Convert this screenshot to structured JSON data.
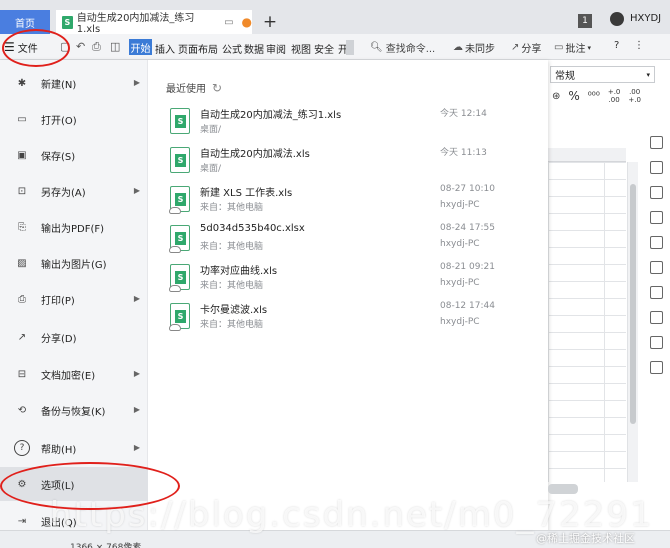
{
  "tabs": {
    "home": "首页",
    "doc_title": "自动生成20内加减法_练习1.xls",
    "badge": "1",
    "username": "HXYDJ"
  },
  "menubar": {
    "file": "文件",
    "start": "开始",
    "items": [
      "插入",
      "页面布局",
      "公式",
      "数据",
      "审阅",
      "视图",
      "安全",
      "开"
    ],
    "search": "查找命令...",
    "sync": "未同步",
    "share": "分享",
    "annotate": "批注",
    "help": "?",
    "more": "⋮"
  },
  "sheet": {
    "number_format": "常规",
    "decimal_up": "+.0\n.00",
    "decimal_down": ".00\n+.0"
  },
  "nav": {
    "items": [
      {
        "label": "新建(N)",
        "icon": "new-icon",
        "arrow": true
      },
      {
        "label": "打开(O)",
        "icon": "folder-open-icon",
        "arrow": false
      },
      {
        "label": "保存(S)",
        "icon": "save-icon",
        "arrow": false
      },
      {
        "label": "另存为(A)",
        "icon": "save-as-icon",
        "arrow": true
      },
      {
        "label": "输出为PDF(F)",
        "icon": "pdf-icon",
        "arrow": false
      },
      {
        "label": "输出为图片(G)",
        "icon": "image-icon",
        "arrow": false
      },
      {
        "label": "打印(P)",
        "icon": "print-icon",
        "arrow": true
      },
      {
        "label": "分享(D)",
        "icon": "share-icon",
        "arrow": false
      },
      {
        "label": "文档加密(E)",
        "icon": "encrypt-icon",
        "arrow": true
      },
      {
        "label": "备份与恢复(K)",
        "icon": "backup-icon",
        "arrow": true
      },
      {
        "label": "帮助(H)",
        "icon": "help-icon",
        "arrow": true
      },
      {
        "label": "选项(L)",
        "icon": "gear-icon",
        "arrow": false
      },
      {
        "label": "退出(Q)",
        "icon": "exit-icon",
        "arrow": false
      }
    ]
  },
  "recent": {
    "title": "最近使用",
    "files": [
      {
        "name": "自动生成20内加减法_练习1.xls",
        "path": "桌面/",
        "time": "今天 12:14",
        "source": ""
      },
      {
        "name": "自动生成20内加减法.xls",
        "path": "桌面/",
        "time": "今天 11:13",
        "source": ""
      },
      {
        "name": "新建 XLS 工作表.xls",
        "path": "来自：其他电脑",
        "time": "08-27 10:10",
        "source": "hxydj-PC"
      },
      {
        "name": "5d034d535b40c.xlsx",
        "path": "来自：其他电脑",
        "time": "08-24 17:55",
        "source": "hxydj-PC"
      },
      {
        "name": "功率对应曲线.xls",
        "path": "来自：其他电脑",
        "time": "08-21 09:21",
        "source": "hxydj-PC"
      },
      {
        "name": "卡尔曼滤波.xls",
        "path": "来自：其他电脑",
        "time": "08-12 17:44",
        "source": "hxydj-PC"
      }
    ]
  },
  "status": {
    "resolution": "1366 × 768像素"
  },
  "watermark": {
    "url": "https://blog.csdn.net/m0_72291",
    "credit": "@稀土掘金技术社区"
  }
}
